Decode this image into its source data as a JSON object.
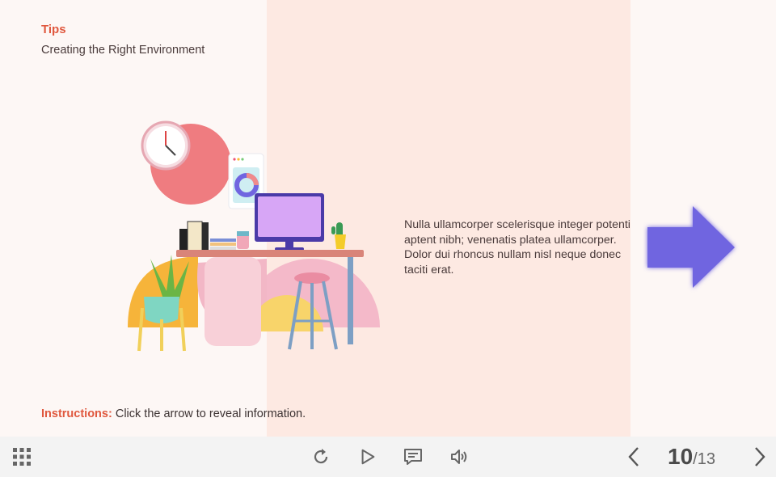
{
  "slide": {
    "heading": "Tips",
    "subtitle": "Creating the Right Environment",
    "body": "Nulla ullamcorper scelerisque integer potenti aptent nibh; venenatis platea ullamcorper. Dolor dui rhoncus nullam nisl neque donec taciti erat.",
    "instructions_label": "Instructions:",
    "instructions_text": " Click the arrow to reveal information.",
    "arrow_icon": "right-arrow-icon",
    "colors": {
      "accent": "#e0583e",
      "arrow": "#7065e0",
      "panel": "#fde9e2"
    }
  },
  "player": {
    "icons": [
      "menu-grid-icon",
      "replay-icon",
      "play-icon",
      "captions-icon",
      "volume-icon",
      "previous-icon",
      "next-icon"
    ],
    "current_page": "10",
    "total_pages": "/13"
  }
}
